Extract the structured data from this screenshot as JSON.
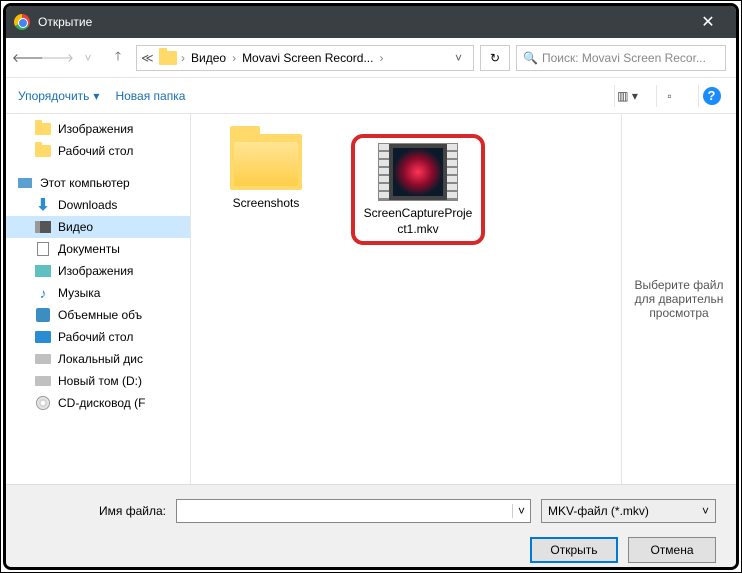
{
  "window": {
    "title": "Открытие"
  },
  "nav": {
    "crumbs": [
      "Видео",
      "Movavi Screen Record..."
    ],
    "search_placeholder": "Поиск: Movavi Screen Recor..."
  },
  "toolbar": {
    "organize": "Упорядочить",
    "new_folder": "Новая папка"
  },
  "tree": {
    "items": [
      {
        "label": "Изображения",
        "icon": "folder"
      },
      {
        "label": "Рабочий стол",
        "icon": "folder"
      },
      {
        "label": "Этот компьютер",
        "icon": "pc",
        "root": true
      },
      {
        "label": "Downloads",
        "icon": "dl"
      },
      {
        "label": "Видео",
        "icon": "video",
        "selected": true
      },
      {
        "label": "Документы",
        "icon": "doc"
      },
      {
        "label": "Изображения",
        "icon": "img"
      },
      {
        "label": "Музыка",
        "icon": "music"
      },
      {
        "label": "Объемные объ",
        "icon": "3d"
      },
      {
        "label": "Рабочий стол",
        "icon": "desktop"
      },
      {
        "label": "Локальный дис",
        "icon": "disk"
      },
      {
        "label": "Новый том (D:)",
        "icon": "disk"
      },
      {
        "label": "CD-дисковод (F",
        "icon": "cd"
      }
    ]
  },
  "files": {
    "folder": {
      "name": "Screenshots"
    },
    "video": {
      "name": "ScreenCaptureProject1.mkv"
    }
  },
  "preview": {
    "text": "Выберите файл для дварительн просмотра"
  },
  "footer": {
    "filename_label": "Имя файла:",
    "filename_value": "",
    "filter": "MKV-файл (*.mkv)",
    "open": "Открыть",
    "cancel": "Отмена"
  }
}
